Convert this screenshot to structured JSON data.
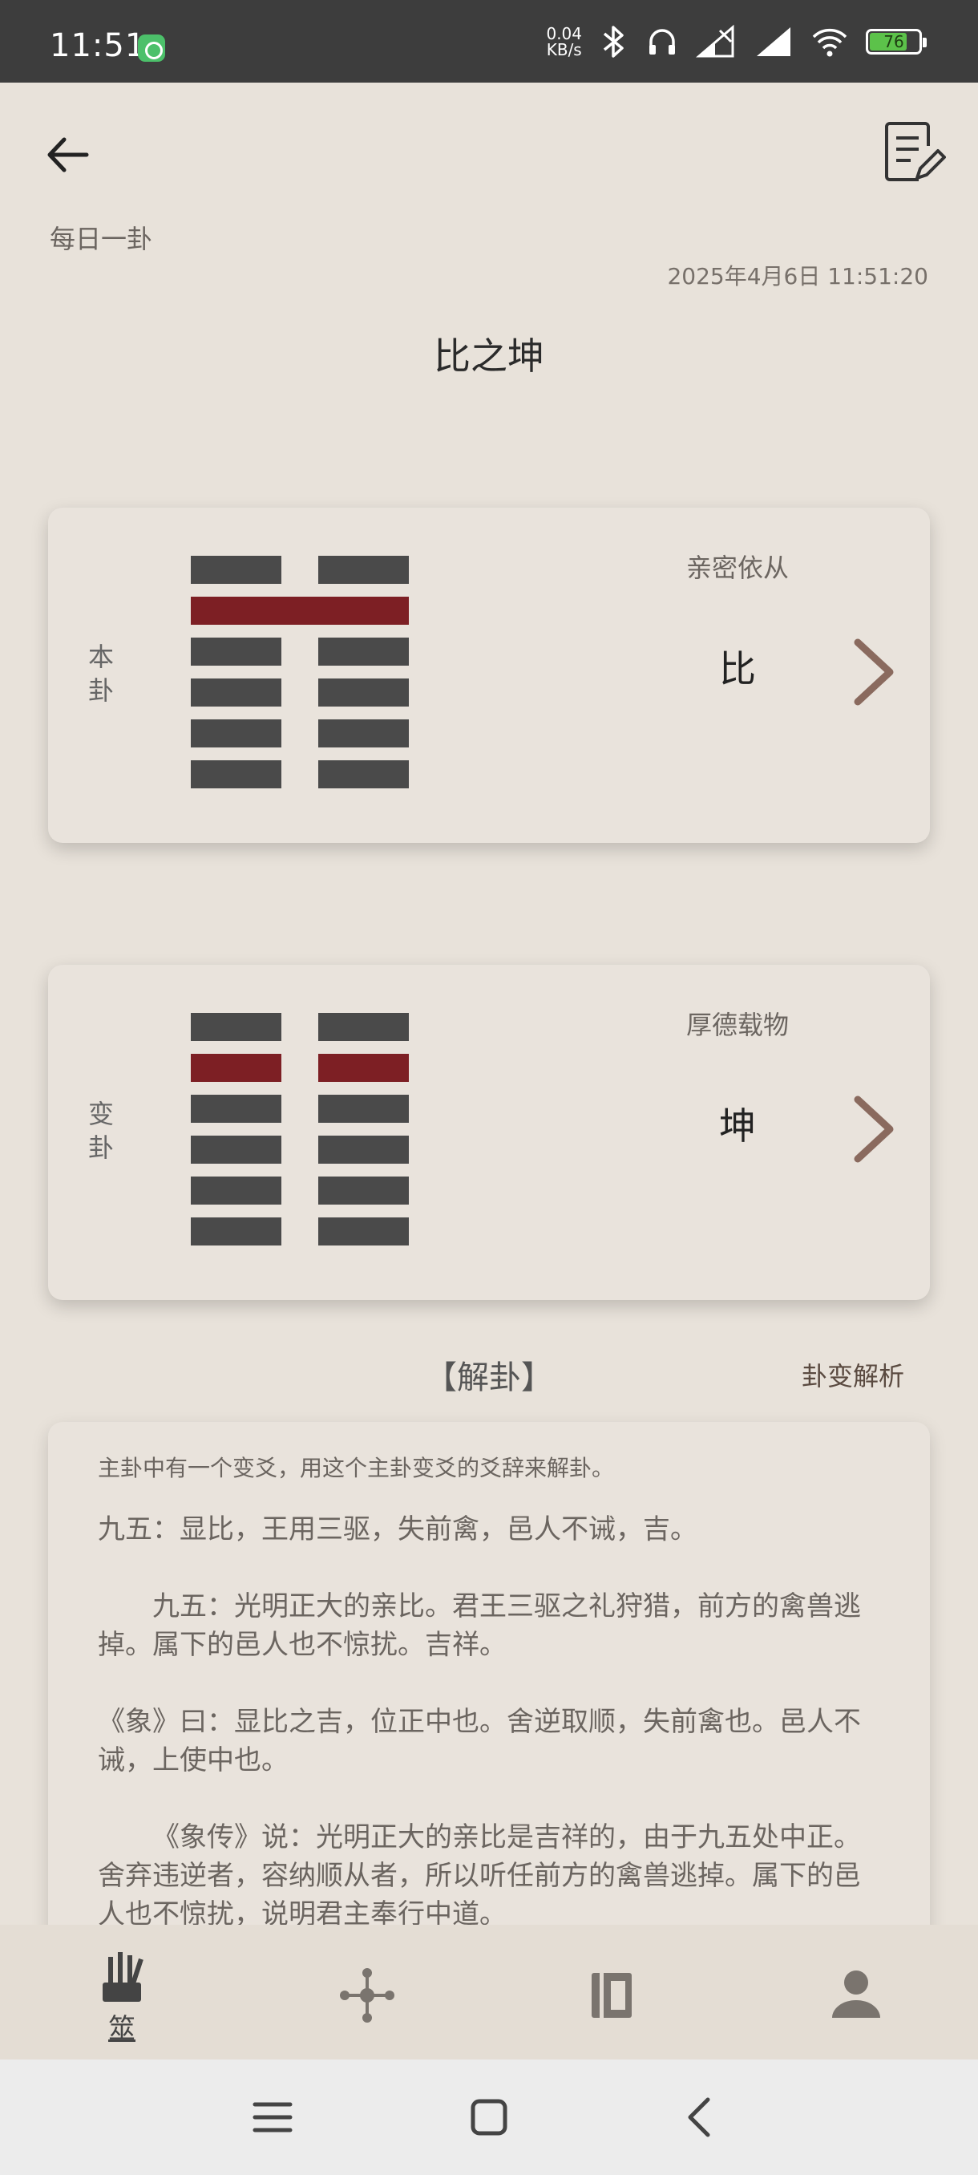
{
  "status_bar": {
    "time": "11:51",
    "net_speed_value": "0.04",
    "net_speed_unit": "KB/s",
    "battery": "76"
  },
  "header": {
    "section_title": "每日一卦",
    "timestamp": "2025年4月6日 11:51:20",
    "gua_title": "比之坤"
  },
  "ben_gua": {
    "label": "本卦",
    "description": "亲密依从",
    "name": "比"
  },
  "bian_gua": {
    "label": "变卦",
    "description": "厚德载物",
    "name": "坤"
  },
  "interpretation": {
    "title": "【解卦】",
    "analysis_link": "卦变解析",
    "note": "主卦中有一个变爻，用这个主卦变爻的爻辞来解卦。",
    "paragraphs": [
      "九五：显比，王用三驱，失前禽，邑人不诫，吉。",
      "九五：光明正大的亲比。君王三驱之礼狩猎，前方的禽兽逃掉。属下的邑人也不惊扰。吉祥。",
      "《象》曰：显比之吉，位正中也。舍逆取顺，失前禽也。邑人不诫，上使中也。",
      "《象传》说：光明正大的亲比是吉祥的，由于九五处中正。舍弃违逆者，容纳顺从者，所以听任前方的禽兽逃掉。属下的邑人也不惊扰，说明君主奉行中道。"
    ]
  },
  "tab_bar": {
    "active_label": "筮"
  },
  "colors": {
    "background": "#e8e2da",
    "status_bar": "#3d3d3d",
    "yao_line": "#4a4a4a",
    "changing_line": "#7d1f24",
    "chevron": "#8a6a5e",
    "battery_fill": "#5cc24a"
  },
  "icons": [
    "back-arrow-icon",
    "notes-edit-icon",
    "chevron-right-icon",
    "divination-sticks-icon",
    "network-nodes-icon",
    "book-icon",
    "user-icon",
    "menu-icon",
    "home-icon",
    "back-icon"
  ]
}
